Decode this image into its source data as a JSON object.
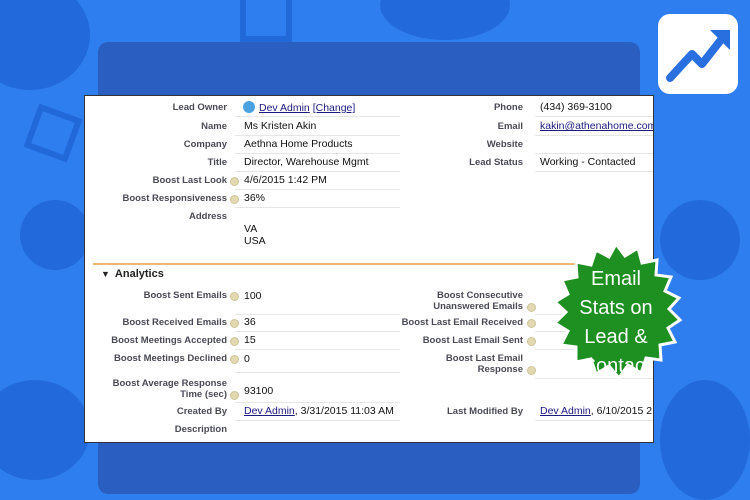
{
  "lead": {
    "owner_label": "Lead Owner",
    "owner_value": "Dev Admin",
    "change_link": "[Change]",
    "name_label": "Name",
    "name_value": "Ms Kristen Akin",
    "company_label": "Company",
    "company_value": "Aethna Home Products",
    "title_label": "Title",
    "title_value": "Director, Warehouse Mgmt",
    "boost_last_look_label": "Boost Last Look",
    "boost_last_look_value": "4/6/2015 1:42 PM",
    "boost_resp_label": "Boost Responsiveness",
    "boost_resp_value": "36%",
    "address_label": "Address",
    "address_line1": "VA",
    "address_line2": "USA",
    "phone_label": "Phone",
    "phone_value": "(434) 369-3100",
    "email_label": "Email",
    "email_value": "kakin@athenahome.com",
    "website_label": "Website",
    "website_value": "",
    "status_label": "Lead Status",
    "status_value": "Working - Contacted"
  },
  "analytics": {
    "title": "Analytics",
    "sent_label": "Boost Sent Emails",
    "sent_value": "100",
    "received_label": "Boost Received Emails",
    "received_value": "36",
    "meetings_acc_label": "Boost Meetings Accepted",
    "meetings_acc_value": "15",
    "meetings_dec_label": "Boost Meetings Declined",
    "meetings_dec_value": "0",
    "avg_resp_label_1": "Boost Average Response",
    "avg_resp_label_2": "Time (sec)",
    "avg_resp_value": "93100",
    "consec_label_1": "Boost Consecutive",
    "consec_label_2": "Unanswered Emails",
    "last_received_label": "Boost Last Email Received",
    "last_sent_label": "Boost Last Email Sent",
    "last_resp_label_1": "Boost Last Email",
    "last_resp_label_2": "Response",
    "created_label": "Created By",
    "created_user": "Dev Admin",
    "created_date": ", 3/31/2015 11:03 AM",
    "modified_label": "Last Modified By",
    "modified_user": "Dev Admin",
    "modified_date": ", 6/10/2015 2",
    "description_label": "Description"
  },
  "badge": {
    "line1": "Email",
    "line2": "Stats on",
    "line3": "Lead &",
    "line4": "Contact",
    "color": "#1e8f21"
  },
  "colors": {
    "background": "#2f7ef0",
    "panel": "#2a5fc1",
    "section_rule": "#f0b770"
  }
}
